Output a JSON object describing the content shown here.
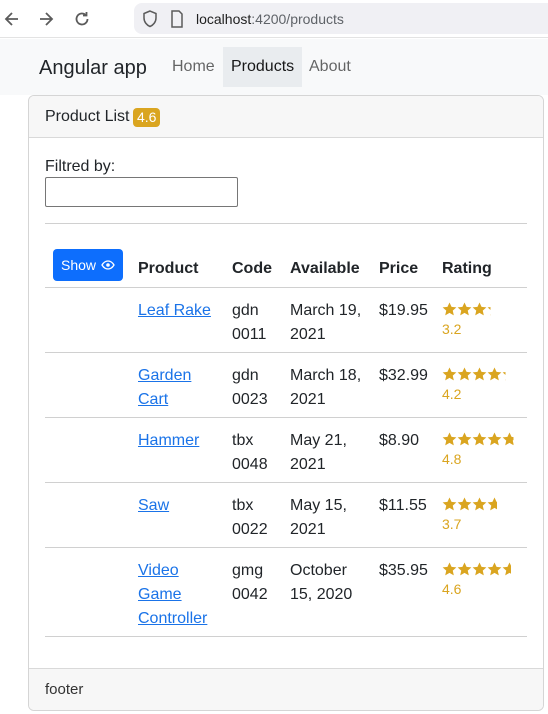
{
  "browser": {
    "url_host": "localhost",
    "url_path": ":4200/products"
  },
  "navbar": {
    "brand": "Angular app",
    "links": [
      {
        "label": "Home"
      },
      {
        "label": "Products"
      },
      {
        "label": "About"
      }
    ],
    "active": "Products"
  },
  "card": {
    "title": "Product List",
    "badge": "4.6",
    "filter_label": "Filtred by:",
    "filter_value": "",
    "show_button": "Show",
    "footer": "footer",
    "colors": {
      "accent": "#0d6efd",
      "badge": "#daa520",
      "link": "#1a73e8",
      "star": "#daa520"
    }
  },
  "table": {
    "headers": [
      "Product",
      "Code",
      "Available",
      "Price",
      "Rating"
    ],
    "rows": [
      {
        "product": [
          "Leaf Rake"
        ],
        "code": [
          "gdn",
          "0011"
        ],
        "available": [
          "March 19,",
          "2021"
        ],
        "price": "$19.95",
        "rating": 3.2,
        "rating_label": "3.2"
      },
      {
        "product": [
          "Garden",
          "Cart"
        ],
        "code": [
          "gdn",
          "0023"
        ],
        "available": [
          "March 18,",
          "2021"
        ],
        "price": "$32.99",
        "rating": 4.2,
        "rating_label": "4.2"
      },
      {
        "product": [
          "Hammer"
        ],
        "code": [
          "tbx",
          "0048"
        ],
        "available": [
          "May 21,",
          "2021"
        ],
        "price": "$8.90",
        "rating": 4.8,
        "rating_label": "4.8"
      },
      {
        "product": [
          "Saw"
        ],
        "code": [
          "tbx",
          "0022"
        ],
        "available": [
          "May 15,",
          "2021"
        ],
        "price": "$11.55",
        "rating": 3.7,
        "rating_label": "3.7"
      },
      {
        "product": [
          "Video",
          "Game",
          "Controller"
        ],
        "code": [
          "gmg",
          "0042"
        ],
        "available": [
          "October",
          "15, 2020"
        ],
        "price": "$35.95",
        "rating": 4.6,
        "rating_label": "4.6"
      }
    ]
  }
}
